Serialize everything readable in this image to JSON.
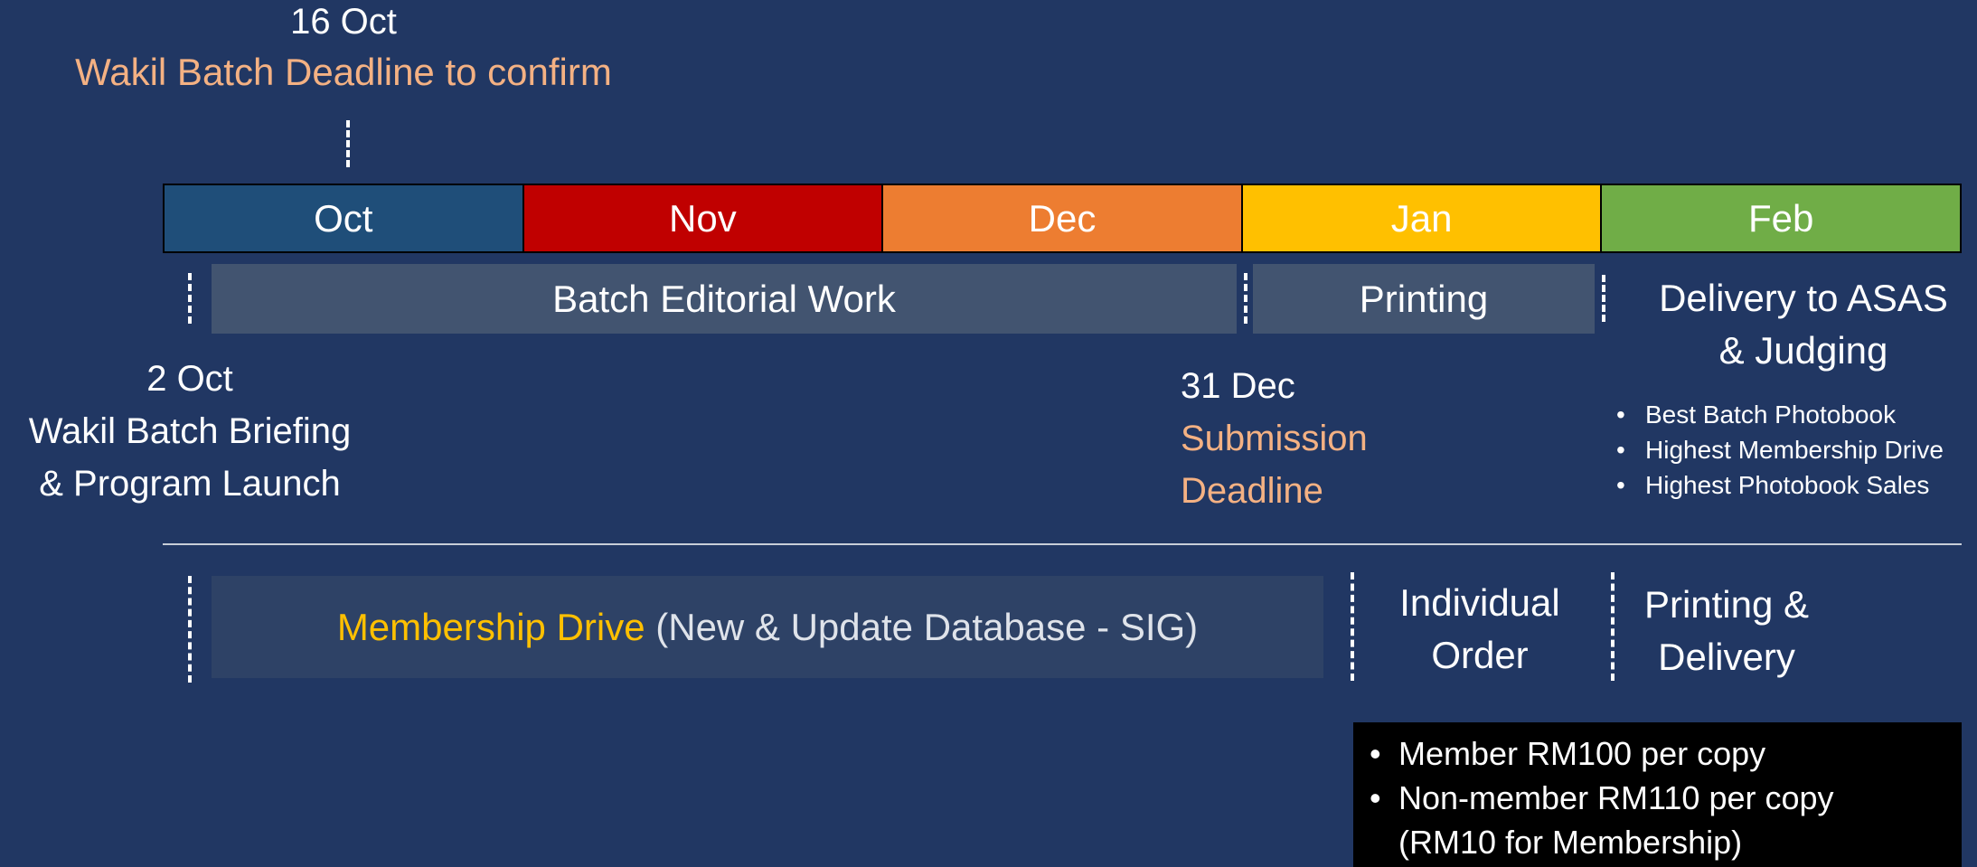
{
  "colors": {
    "background": "#213763",
    "oct": "#1f4e79",
    "nov": "#c00000",
    "dec": "#ed7d31",
    "jan": "#ffc000",
    "feb": "#70ad47",
    "phase_box": "#425470",
    "membership_box": "#2e4266",
    "accent_orange": "#f4b183",
    "accent_yellow": "#ffc000",
    "muted_text": "#dfe3ea"
  },
  "top_milestone": {
    "date": "16 Oct",
    "label": "Wakil Batch Deadline to confirm"
  },
  "months": [
    {
      "label": "Oct",
      "color": "#1f4e79"
    },
    {
      "label": "Nov",
      "color": "#c00000"
    },
    {
      "label": "Dec",
      "color": "#ed7d31"
    },
    {
      "label": "Jan",
      "color": "#ffc000"
    },
    {
      "label": "Feb",
      "color": "#70ad47"
    }
  ],
  "phases": {
    "editorial": "Batch Editorial Work",
    "printing": "Printing",
    "delivery_line1": "Delivery to ASAS",
    "delivery_line2": "& Judging"
  },
  "briefing": {
    "date": "2 Oct",
    "line1": "Wakil Batch Briefing",
    "line2": "& Program Launch"
  },
  "submission": {
    "date": "31 Dec",
    "line1": "Submission",
    "line2": "Deadline"
  },
  "awards": [
    "Best Batch Photobook",
    "Highest Membership Drive",
    "Highest Photobook Sales"
  ],
  "membership": {
    "highlight": "Membership Drive",
    "rest": " (New & Update Database - SIG)"
  },
  "individual_order": {
    "line1": "Individual",
    "line2": "Order"
  },
  "printing_delivery": {
    "line1": "Printing &",
    "line2": "Delivery"
  },
  "pricing": {
    "item1": "Member RM100 per copy",
    "item2_line1": "Non-member RM110 per copy",
    "item2_line2": "(RM10 for Membership)"
  }
}
